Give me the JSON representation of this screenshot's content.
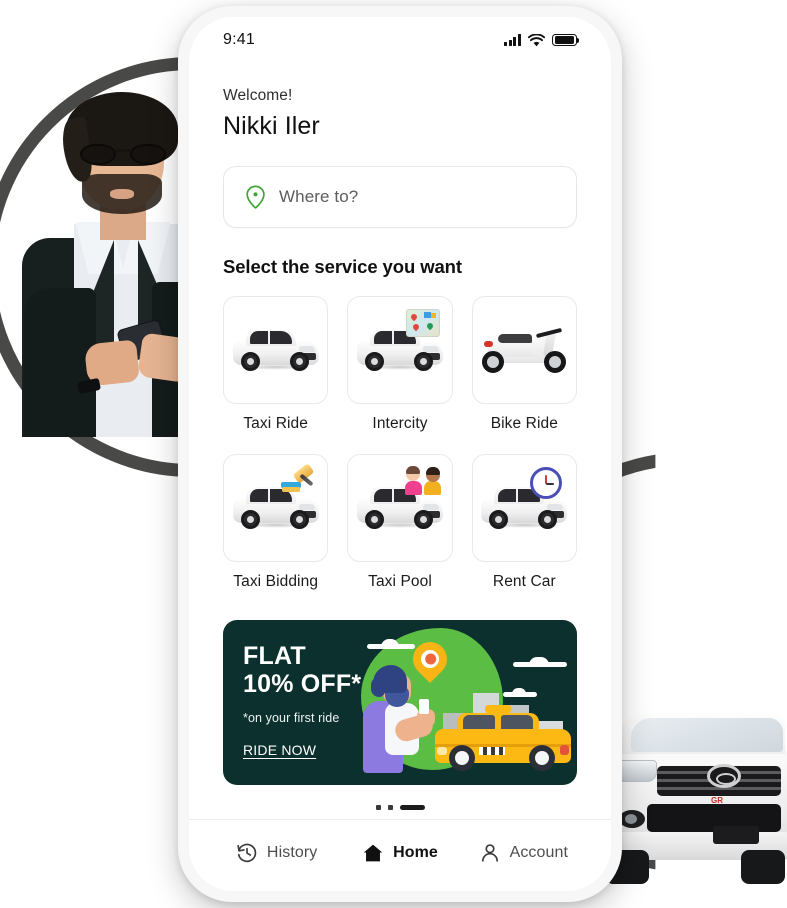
{
  "status_bar": {
    "time": "9:41",
    "signal_icon": "cellular-signal-icon",
    "wifi_icon": "wifi-icon",
    "battery_icon": "battery-full-icon"
  },
  "header": {
    "greeting": "Welcome!",
    "user_name": "Nikki Iler"
  },
  "search": {
    "placeholder": "Where to?",
    "value": "",
    "icon": "location-pin-icon",
    "icon_color": "#3fa535"
  },
  "services": {
    "section_title": "Select the service you want",
    "items": [
      {
        "label": "Taxi Ride",
        "art": "white-sedan-car",
        "badge": "none"
      },
      {
        "label": "Intercity",
        "art": "white-sedan-car",
        "badge": "map-icon"
      },
      {
        "label": "Bike Ride",
        "art": "white-scooter",
        "badge": "none"
      },
      {
        "label": "Taxi Bidding",
        "art": "white-sedan-car",
        "badge": "gavel-icon"
      },
      {
        "label": "Taxi Pool",
        "art": "white-sedan-car",
        "badge": "two-people-icon"
      },
      {
        "label": "Rent Car",
        "art": "white-sedan-car",
        "badge": "clock-icon"
      }
    ]
  },
  "promo": {
    "line1": "FLAT",
    "line2": "10% OFF*",
    "disclaimer": "*on your first ride",
    "cta": "RIDE NOW",
    "background_color": "#0c302d",
    "accent_green": "#5cbd45",
    "taxi_yellow": "#fcb813",
    "pin_color": "#f8b315"
  },
  "carousel": {
    "total_dots": 3,
    "active_index": 2
  },
  "bottom_nav": {
    "items": [
      {
        "label": "History",
        "icon": "clock-rewind-icon",
        "active": false
      },
      {
        "label": "Home",
        "icon": "home-icon",
        "active": true
      },
      {
        "label": "Account",
        "icon": "person-icon",
        "active": false
      }
    ]
  },
  "decor": {
    "left_photo": "man-with-sunglasses-using-phone",
    "right_photo": "white-toyota-suv-front",
    "ring_color": "#3a3937",
    "suv_badge_text": "GR"
  }
}
